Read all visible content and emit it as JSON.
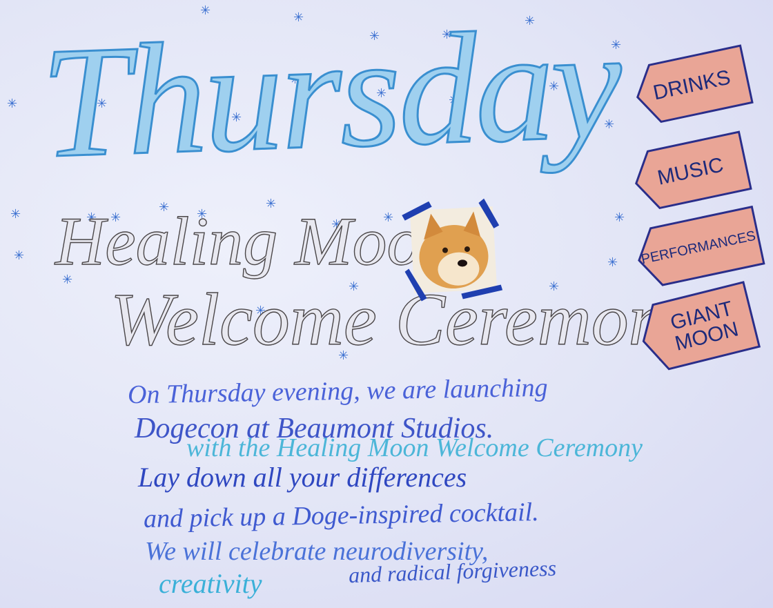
{
  "title": "Thursday",
  "subtitle_line1": "Healing Moon",
  "subtitle_line2": "Welcome Ceremony",
  "paragraph": {
    "lines": [
      "On Thursday evening, we are launching",
      "Dogecon at Beaumont Studios.",
      "Lay down all your differences",
      "and pick up a Doge-inspired cocktail.",
      "We will celebrate neurodiversity,",
      "creativity",
      "and radical forgiveness"
    ],
    "insertion": "with the Healing Moon Welcome Ceremony"
  },
  "tags": [
    "DRINKS",
    "MUSIC",
    "PERFORMANCES",
    "GIANT MOON"
  ],
  "colors": {
    "title": "#3a8fd0",
    "tag_fill": "#e49a8c",
    "tag_ink": "#1d2a7a",
    "tape": "#1f3fb0",
    "paper": "#e4e6f8"
  }
}
